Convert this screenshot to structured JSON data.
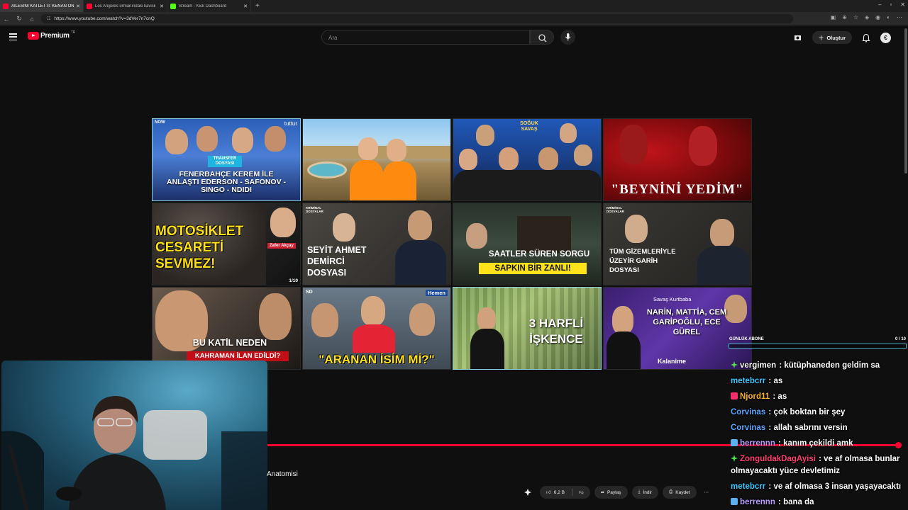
{
  "browser": {
    "tabs": [
      {
        "title": "AİLESİNİ KATLETTİ: KENAN ÖNE",
        "active": true,
        "favicon": "youtube-red"
      },
      {
        "title": "Los Angeles ormanındaki kavisli",
        "active": false,
        "favicon": "youtube-red"
      },
      {
        "title": "Stream - Kick Dashboard",
        "active": false,
        "favicon": "kick-green"
      }
    ],
    "url": "https://www.youtube.com/watch?v=3dVer7n7cnQ",
    "new_tab": "+"
  },
  "youtube": {
    "logo_text": "Premium",
    "logo_region": "TR",
    "search_placeholder": "Ara",
    "create_label": "Oluştur",
    "avatar_letter": "€"
  },
  "end_screen": [
    {
      "caption": "FENERBAHÇE KEREM İLE ANLAŞTI EDERSON - SAFONOV - SINGO - NDIDI",
      "tag": "NOW",
      "corner": "tuttur",
      "badge": "TRANSFER DOSYASI"
    },
    {
      "caption": ""
    },
    {
      "caption": "",
      "tag": "SOĞUK SAVAŞ"
    },
    {
      "caption": "\"BEYNİNİ YEDİM\""
    },
    {
      "caption": "MOTOSİKLET CESARETİ SEVMEZ!",
      "name": "Zafer Akçay",
      "counter": "1/10"
    },
    {
      "caption": "SEYİT AHMET DEMİRCİ DOSYASI",
      "tag": "KRİMİNAL DOSYALAR"
    },
    {
      "caption": "SAATLER SÜREN SORGU",
      "sub": "SAPKIN BİR ZANLI!"
    },
    {
      "caption": "TÜM GİZEMLERİYLE ÜZEYİR GARİH DOSYASI",
      "tag": "KRİMİNAL DOSYALAR"
    },
    {
      "caption": "BU KATİL NEDEN",
      "sub": "KAHRAMAN İLAN EDİLDİ?"
    },
    {
      "caption": "\"ARANAN İSİM Mİ?\"",
      "tag": "SD",
      "corner": "Hemen"
    },
    {
      "caption": "3 HARFLİ İŞKENCE"
    },
    {
      "caption": "NARİN, MATTİA, CEM GARİPOĞLU, ECE GÜREL",
      "tag": "Savaş Kurtbaba",
      "corner": "Kalanime"
    }
  ],
  "player": {
    "progress_fraction": 0.995,
    "video_title_fragment": "Anatomisi",
    "actions": {
      "like_count": "6,2 B",
      "share": "Paylaş",
      "download": "İndir",
      "save": "Kaydet"
    }
  },
  "overlay": {
    "goal_label": "GÜNLÜK ABONE",
    "goal_count": "0 / 10",
    "chat": [
      {
        "user": "vergimen",
        "color": "#ffffff",
        "badge": "green",
        "text": "kütüphaneden geldim sa"
      },
      {
        "user": "metebcrr",
        "color": "#3ac6ff",
        "badge": "",
        "text": "as"
      },
      {
        "user": "Njord11",
        "color": "#f5b324",
        "badge": "red",
        "text": "as"
      },
      {
        "user": "Corvinas",
        "color": "#5aa8ff",
        "badge": "",
        "text": "çok boktan bir şey"
      },
      {
        "user": "Corvinas",
        "color": "#5aa8ff",
        "badge": "",
        "text": "allah sabrını versin"
      },
      {
        "user": "berrennn",
        "color": "#b99cff",
        "badge": "blue",
        "text": "kanım çekildi amk"
      },
      {
        "user": "ZonguldakDagAyisi",
        "color": "#ff3d6e",
        "badge": "green",
        "text": "ve af olmasa bunlar olmayacaktı yüce devletimiz"
      },
      {
        "user": "metebcrr",
        "color": "#3ac6ff",
        "badge": "",
        "text": "ve af olmasa 3 insan yaşayacaktı"
      },
      {
        "user": "berrennn",
        "color": "#b99cff",
        "badge": "blue",
        "text": "bana da"
      }
    ]
  }
}
